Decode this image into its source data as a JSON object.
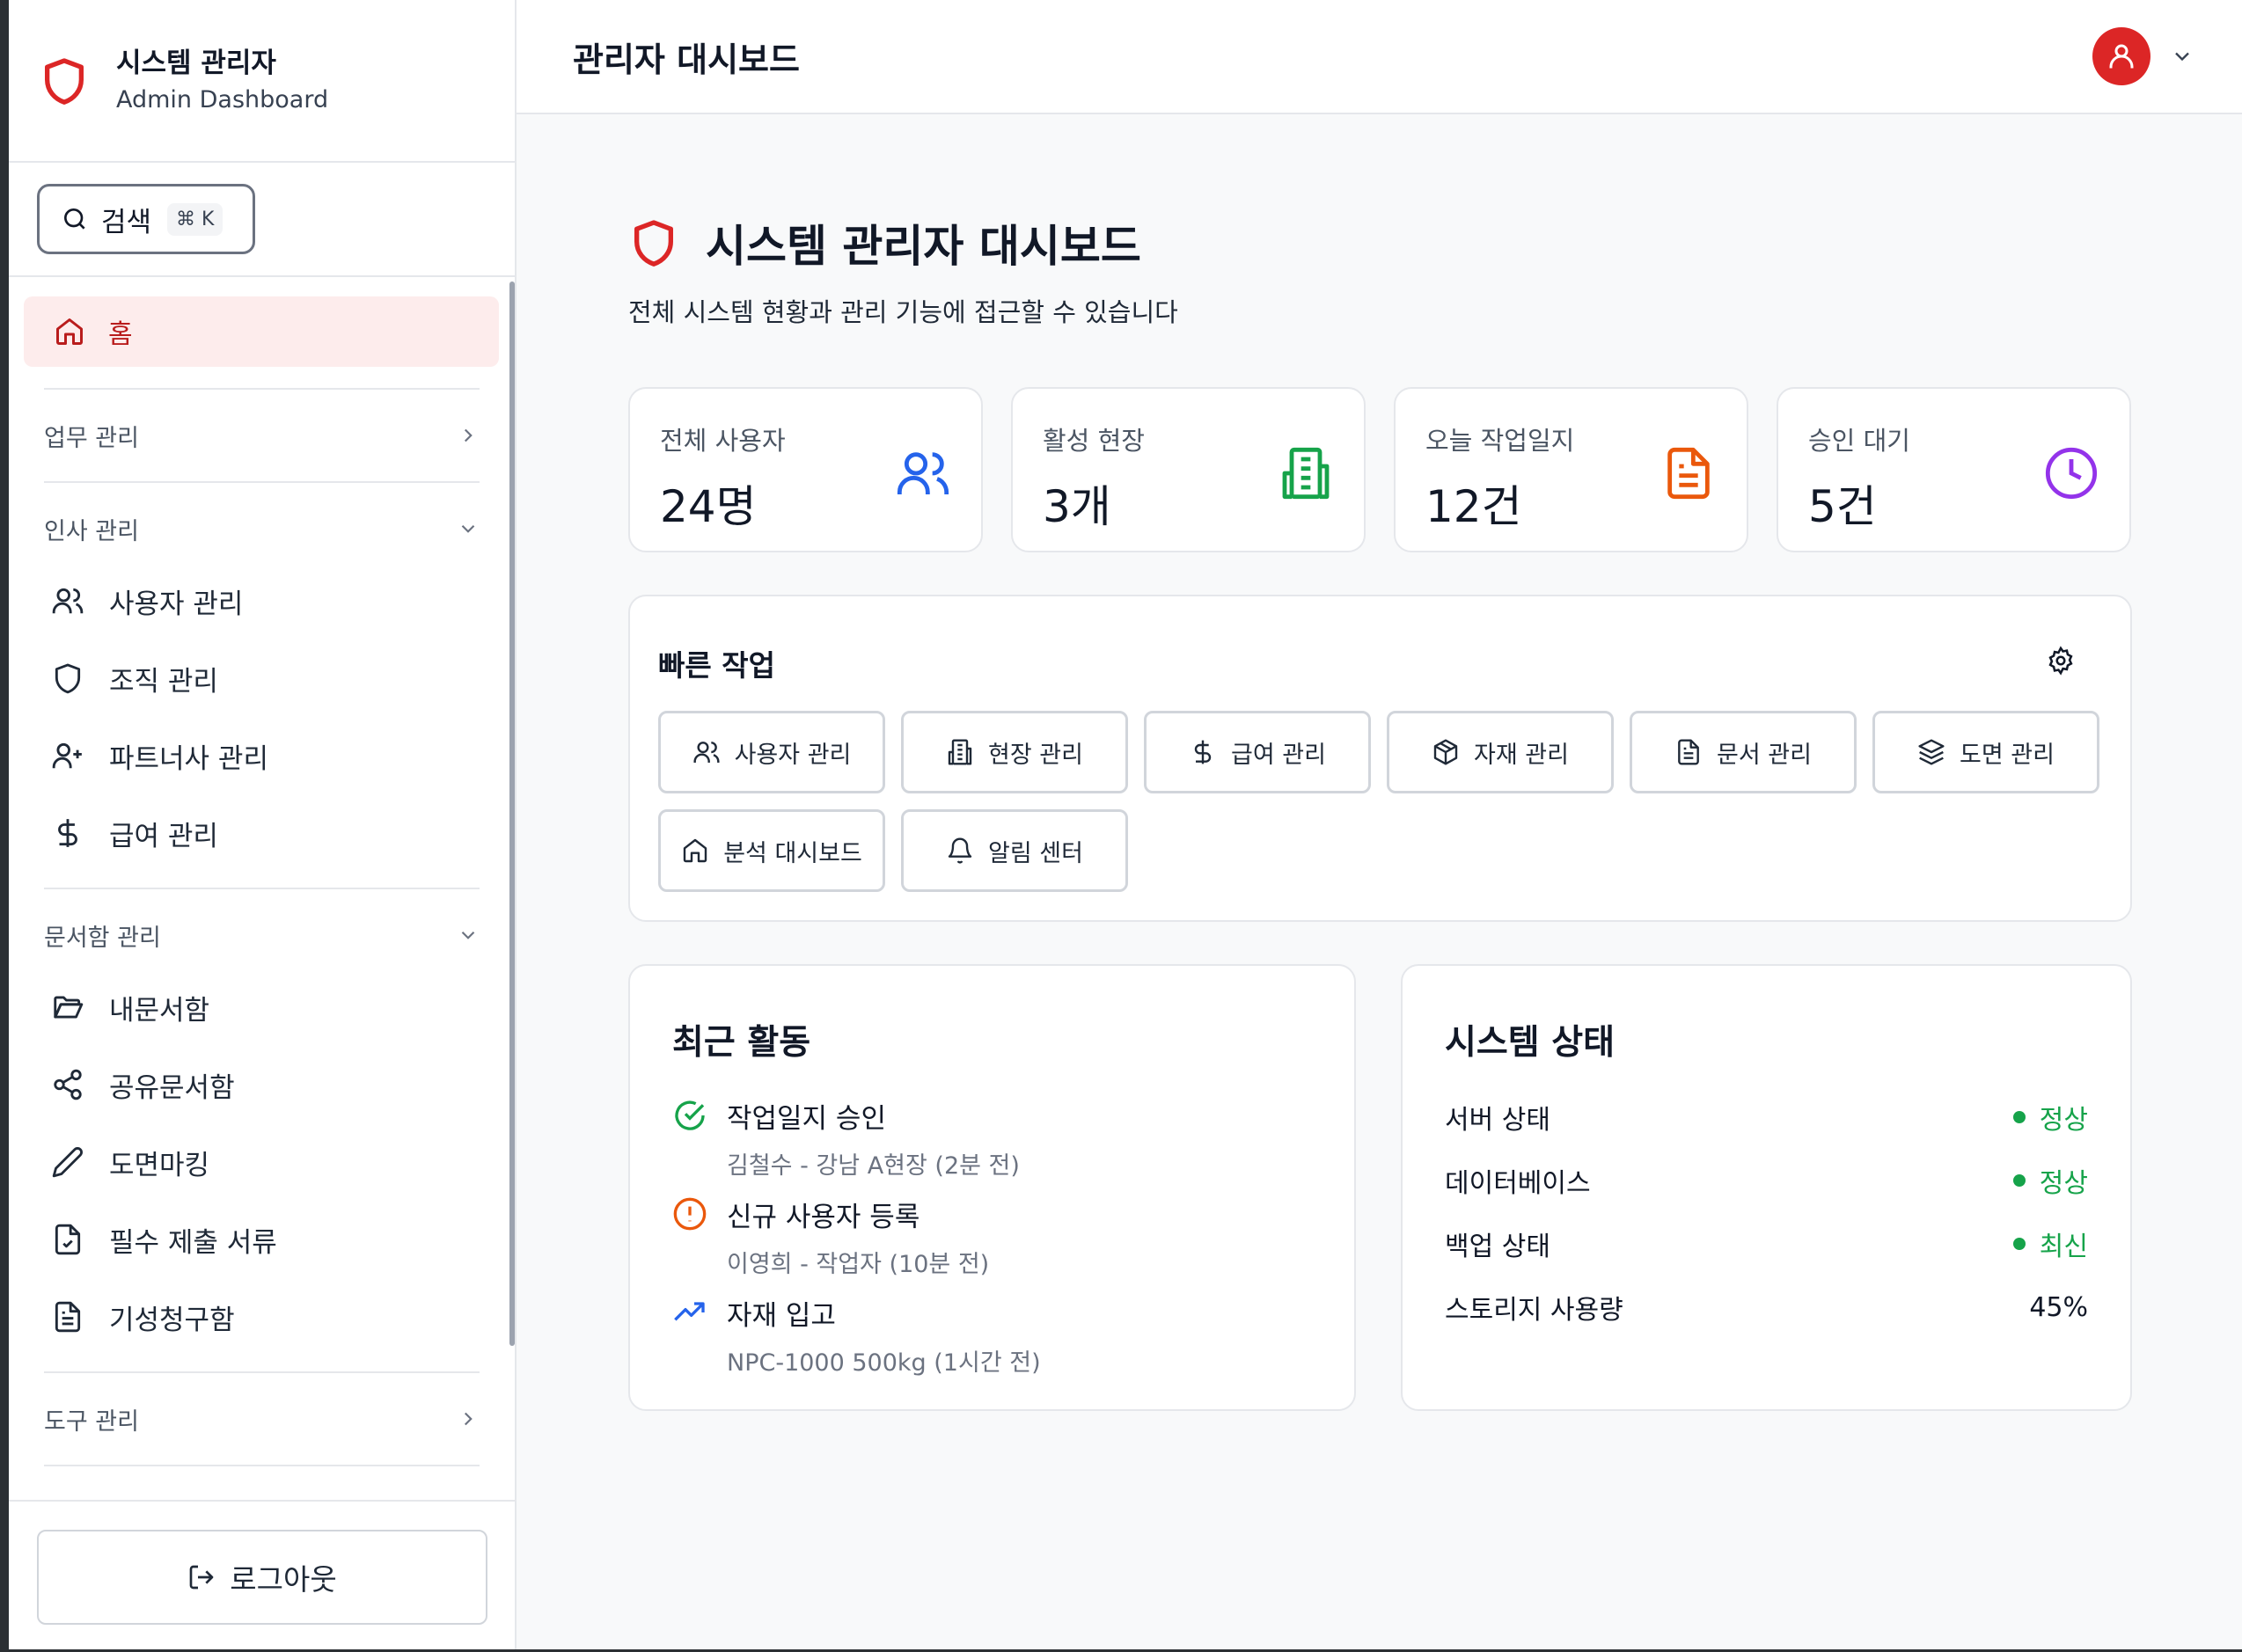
{
  "brand": {
    "title": "시스템 관리자",
    "subtitle": "Admin Dashboard"
  },
  "search": {
    "label": "검색",
    "shortcut": "⌘ K"
  },
  "sidebar": {
    "home": "홈",
    "sections": [
      {
        "label": "업무 관리",
        "expanded": false,
        "items": []
      },
      {
        "label": "인사 관리",
        "expanded": true,
        "items": [
          "사용자 관리",
          "조직 관리",
          "파트너사 관리",
          "급여 관리"
        ]
      },
      {
        "label": "문서함 관리",
        "expanded": true,
        "items": [
          "내문서함",
          "공유문서함",
          "도면마킹",
          "필수 제출 서류",
          "기성청구함"
        ]
      },
      {
        "label": "도구 관리",
        "expanded": false,
        "items": []
      }
    ],
    "logout": "로그아웃"
  },
  "topbar": {
    "title": "관리자 대시보드"
  },
  "page": {
    "title": "시스템 관리자 대시보드",
    "description": "전체 시스템 현황과 관리 기능에 접근할 수 있습니다"
  },
  "stats": [
    {
      "label": "전체 사용자",
      "value": "24명",
      "icon": "users-icon",
      "color": "#2563eb"
    },
    {
      "label": "활성 현장",
      "value": "3개",
      "icon": "building-icon",
      "color": "#16a34a"
    },
    {
      "label": "오늘 작업일지",
      "value": "12건",
      "icon": "document-icon",
      "color": "#ea580c"
    },
    {
      "label": "승인 대기",
      "value": "5건",
      "icon": "clock-icon",
      "color": "#9333ea"
    }
  ],
  "quick": {
    "title": "빠른 작업",
    "buttons": [
      "사용자 관리",
      "현장 관리",
      "급여 관리",
      "자재 관리",
      "문서 관리",
      "도면 관리",
      "분석 대시보드",
      "알림 센터"
    ]
  },
  "recent": {
    "title": "최근 활동",
    "items": [
      {
        "title": "작업일지 승인",
        "sub": "김철수 - 강남 A현장 (2분 전)",
        "icon": "check-circle-icon",
        "color": "#16a34a"
      },
      {
        "title": "신규 사용자 등록",
        "sub": "이영희 - 작업자 (10분 전)",
        "icon": "alert-circle-icon",
        "color": "#ea580c"
      },
      {
        "title": "자재 입고",
        "sub": "NPC-1000 500kg (1시간 전)",
        "icon": "trending-up-icon",
        "color": "#2563eb"
      }
    ]
  },
  "system": {
    "title": "시스템 상태",
    "rows": [
      {
        "label": "서버 상태",
        "value": "정상"
      },
      {
        "label": "데이터베이스",
        "value": "정상"
      },
      {
        "label": "백업 상태",
        "value": "최신"
      },
      {
        "label": "스토리지 사용량",
        "value": "45%"
      }
    ]
  },
  "colors": {
    "accent": "#dc2626",
    "success": "#16a34a",
    "home_bg": "#fdecec"
  }
}
